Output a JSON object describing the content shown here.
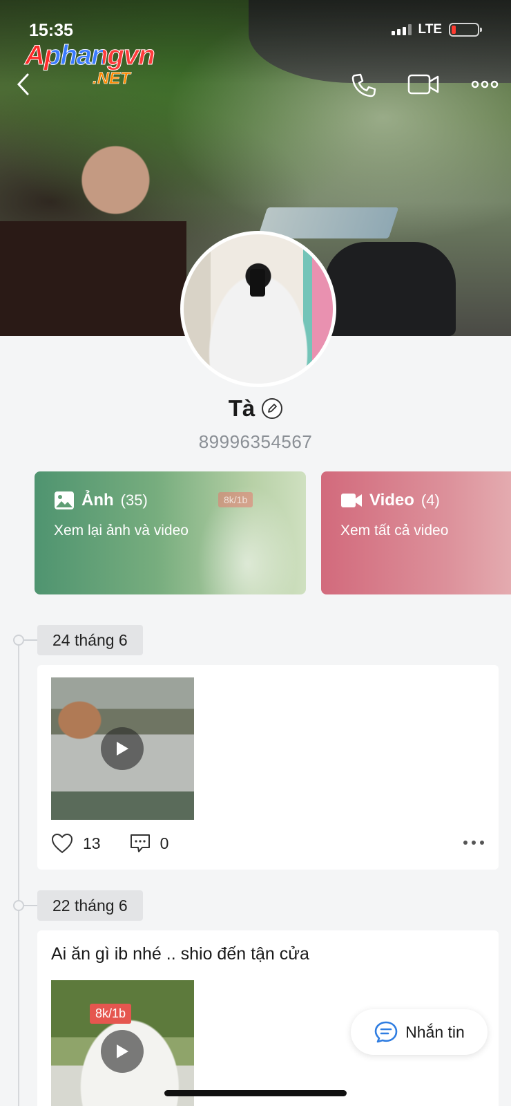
{
  "status_bar": {
    "time": "15:35",
    "network": "LTE"
  },
  "watermark": {
    "line1": "Aphangvn",
    "line2": ".NET"
  },
  "profile": {
    "name": "Tà",
    "phone": "89996354567"
  },
  "cards": {
    "photo": {
      "title": "Ảnh",
      "count": "(35)",
      "subtitle": "Xem lại ảnh và video",
      "tag": "8k/1b"
    },
    "video": {
      "title": "Video",
      "count": "(4)",
      "subtitle": "Xem tất cả video"
    }
  },
  "posts": [
    {
      "date": "24 tháng 6",
      "likes": "13",
      "comments": "0"
    },
    {
      "date": "22 tháng 6",
      "caption": "Ai ăn gì ib nhé .. shio đến tận cửa",
      "price_tag": "8k/1b"
    }
  ],
  "message_button": {
    "label": "Nhắn tin"
  },
  "colors": {
    "photo_card": "#5f9e75",
    "video_card": "#d6727f",
    "message_icon": "#2f7de1"
  }
}
